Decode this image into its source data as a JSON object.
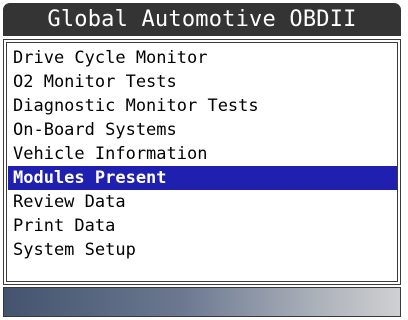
{
  "header": {
    "title": "Global Automotive OBDII"
  },
  "menu": {
    "selected_index": 5,
    "items": [
      {
        "label": "Drive Cycle Monitor"
      },
      {
        "label": "O2 Monitor Tests"
      },
      {
        "label": "Diagnostic Monitor Tests"
      },
      {
        "label": "On-Board Systems"
      },
      {
        "label": "Vehicle Information"
      },
      {
        "label": "Modules Present"
      },
      {
        "label": "Review Data"
      },
      {
        "label": "Print Data"
      },
      {
        "label": "System Setup"
      }
    ]
  },
  "colors": {
    "title_bar": "#343434",
    "selection": "#2020b0",
    "status_gradient_start": "#44546e",
    "status_gradient_end": "#cfd0d2"
  }
}
